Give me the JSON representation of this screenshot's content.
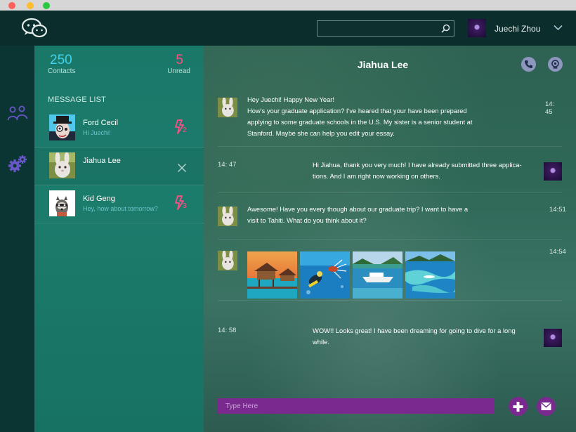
{
  "header": {
    "search_placeholder": "",
    "user_name": "Juechi Zhou"
  },
  "stats": {
    "contacts_count": "250",
    "contacts_label": "Contacts",
    "unread_count": "5",
    "unread_label": "Unread"
  },
  "message_list": {
    "title": "MESSAGE LIST",
    "contacts": [
      {
        "name": "Ford Cecil",
        "preview": "Hi Juechi!",
        "badge": "2"
      },
      {
        "name": "Jiahua Lee",
        "preview": "",
        "badge": ""
      },
      {
        "name": "Kid Geng",
        "preview": "Hey, how about tomorrow?",
        "badge": "3"
      }
    ]
  },
  "chat": {
    "title": "Jiahua Lee",
    "messages": [
      {
        "sender": "Jiahua Lee",
        "lines": [
          "Hey Juechi! Happy New Year!",
          "How's your graduate application? I've heared that your have been prepared",
          "applying to some graduate schools in the U.S. My sister is a senior student at",
          "Stanford. Maybe she can help you edit your essay."
        ],
        "time": "14: 45"
      },
      {
        "sender": "Juechi Zhou",
        "lines": [
          "Hi Jiahua, thank you very much! I have already submitted three applica-",
          "tions. And I am right now working on others."
        ],
        "time": "14: 47"
      },
      {
        "sender": "Jiahua Lee",
        "lines": [
          "Awesome! Have you every though about our graduate trip? I want to have a",
          "visit to Tahiti. What do you think about it?"
        ],
        "time": "14:51"
      },
      {
        "sender": "Jiahua Lee",
        "photos": [
          "overwater-bungalow-photo",
          "scuba-diver-photo",
          "boat-photo",
          "island-reef-photo"
        ],
        "time": "14:54"
      },
      {
        "sender": "Juechi Zhou",
        "lines": [
          "WOW!! Looks great! I have been dreaming for going to dive for a long",
          "while."
        ],
        "time": "14: 58"
      }
    ],
    "composer_placeholder": "Type Here"
  },
  "colors": {
    "accent_purple": "#7a2a8e",
    "contacts_blue": "#3ed2ee",
    "unread_pink": "#ff4d86",
    "panel_teal": "#1a7869"
  }
}
